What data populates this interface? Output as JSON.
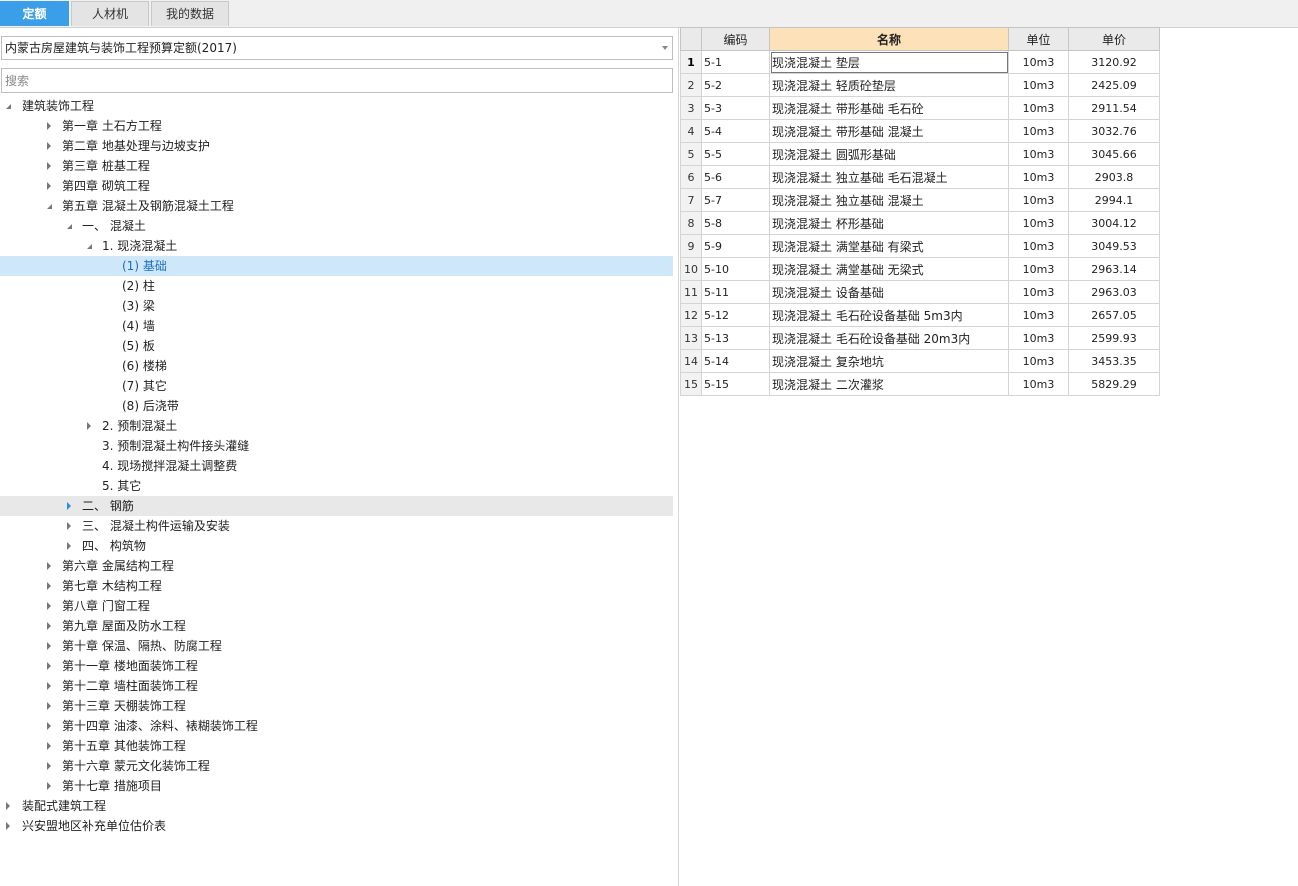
{
  "tabs": [
    "定额",
    "人材机",
    "我的数据"
  ],
  "library_select": "内蒙古房屋建筑与装饰工程预算定额(2017)",
  "search_placeholder": "搜索",
  "tree": [
    {
      "label": "建筑装饰工程",
      "state": "expanded"
    },
    {
      "label": "第一章 土石方工程",
      "state": "collapsed"
    },
    {
      "label": "第二章 地基处理与边坡支护",
      "state": "collapsed"
    },
    {
      "label": "第三章 桩基工程",
      "state": "collapsed"
    },
    {
      "label": "第四章 砌筑工程",
      "state": "collapsed"
    },
    {
      "label": "第五章 混凝土及钢筋混凝土工程",
      "state": "expanded"
    },
    {
      "label": "一、 混凝土",
      "state": "expanded"
    },
    {
      "label": "1. 现浇混凝土",
      "state": "expanded"
    },
    {
      "label": "(1) 基础",
      "state": "leaf",
      "selected": true
    },
    {
      "label": "(2) 柱",
      "state": "leaf"
    },
    {
      "label": "(3) 梁",
      "state": "leaf"
    },
    {
      "label": "(4) 墙",
      "state": "leaf"
    },
    {
      "label": "(5) 板",
      "state": "leaf"
    },
    {
      "label": "(6) 楼梯",
      "state": "leaf"
    },
    {
      "label": "(7) 其它",
      "state": "leaf"
    },
    {
      "label": "(8) 后浇带",
      "state": "leaf"
    },
    {
      "label": "2. 预制混凝土",
      "state": "collapsed"
    },
    {
      "label": "3. 预制混凝土构件接头灌缝",
      "state": "leaf"
    },
    {
      "label": "4. 现场搅拌混凝土调整费",
      "state": "leaf"
    },
    {
      "label": "5. 其它",
      "state": "leaf"
    },
    {
      "label": "二、 钢筋",
      "state": "collapsed",
      "hover": true
    },
    {
      "label": "三、 混凝土构件运输及安装",
      "state": "collapsed"
    },
    {
      "label": "四、 构筑物",
      "state": "collapsed"
    },
    {
      "label": "第六章 金属结构工程",
      "state": "collapsed"
    },
    {
      "label": "第七章 木结构工程",
      "state": "collapsed"
    },
    {
      "label": "第八章 门窗工程",
      "state": "collapsed"
    },
    {
      "label": "第九章 屋面及防水工程",
      "state": "collapsed"
    },
    {
      "label": "第十章 保温、隔热、防腐工程",
      "state": "collapsed"
    },
    {
      "label": "第十一章 楼地面装饰工程",
      "state": "collapsed"
    },
    {
      "label": "第十二章 墙柱面装饰工程",
      "state": "collapsed"
    },
    {
      "label": "第十三章 天棚装饰工程",
      "state": "collapsed"
    },
    {
      "label": "第十四章 油漆、涂料、裱糊装饰工程",
      "state": "collapsed"
    },
    {
      "label": "第十五章 其他装饰工程",
      "state": "collapsed"
    },
    {
      "label": "第十六章 蒙元文化装饰工程",
      "state": "collapsed"
    },
    {
      "label": "第十七章 措施项目",
      "state": "collapsed"
    },
    {
      "label": "装配式建筑工程",
      "state": "collapsed"
    },
    {
      "label": "兴安盟地区补充单位估价表",
      "state": "collapsed"
    }
  ],
  "table": {
    "headers": [
      "编码",
      "名称",
      "单位",
      "单价"
    ],
    "rows": [
      [
        "1",
        "5-1",
        "现浇混凝土 垫层",
        "10m3",
        "3120.92"
      ],
      [
        "2",
        "5-2",
        "现浇混凝土 轻质砼垫层",
        "10m3",
        "2425.09"
      ],
      [
        "3",
        "5-3",
        "现浇混凝土 带形基础 毛石砼",
        "10m3",
        "2911.54"
      ],
      [
        "4",
        "5-4",
        "现浇混凝土 带形基础 混凝土",
        "10m3",
        "3032.76"
      ],
      [
        "5",
        "5-5",
        "现浇混凝土 圆弧形基础",
        "10m3",
        "3045.66"
      ],
      [
        "6",
        "5-6",
        "现浇混凝土 独立基础 毛石混凝土",
        "10m3",
        "2903.8"
      ],
      [
        "7",
        "5-7",
        "现浇混凝土 独立基础 混凝土",
        "10m3",
        "2994.1"
      ],
      [
        "8",
        "5-8",
        "现浇混凝土 杯形基础",
        "10m3",
        "3004.12"
      ],
      [
        "9",
        "5-9",
        "现浇混凝土 满堂基础 有梁式",
        "10m3",
        "3049.53"
      ],
      [
        "10",
        "5-10",
        "现浇混凝土 满堂基础 无梁式",
        "10m3",
        "2963.14"
      ],
      [
        "11",
        "5-11",
        "现浇混凝土 设备基础",
        "10m3",
        "2963.03"
      ],
      [
        "12",
        "5-12",
        "现浇混凝土 毛石砼设备基础 5m3内",
        "10m3",
        "2657.05"
      ],
      [
        "13",
        "5-13",
        "现浇混凝土 毛石砼设备基础 20m3内",
        "10m3",
        "2599.93"
      ],
      [
        "14",
        "5-14",
        "现浇混凝土 复杂地坑",
        "10m3",
        "3453.35"
      ],
      [
        "15",
        "5-15",
        "现浇混凝土 二次灌浆",
        "10m3",
        "5829.29"
      ]
    ]
  }
}
